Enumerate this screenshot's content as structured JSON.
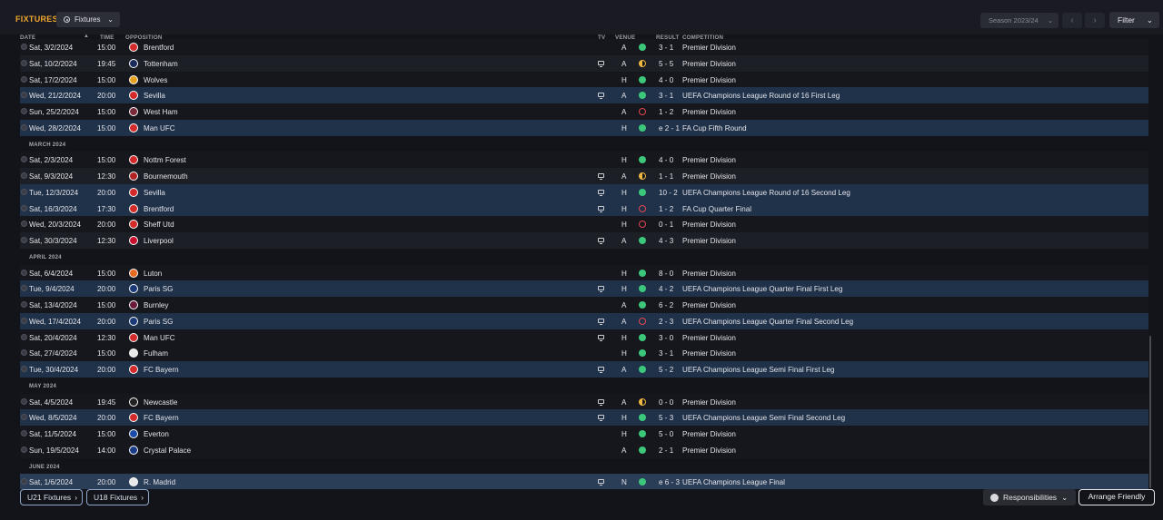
{
  "header": {
    "title": "FIXTURES",
    "view_label": "Fixtures",
    "season_label": "Season 2023/24",
    "filter_label": "Filter"
  },
  "columns": {
    "date": "DATE",
    "time": "TIME",
    "opposition": "OPPOSITION",
    "tv": "TV",
    "venue": "VENUE",
    "result": "RESULT",
    "competition": "COMPETITION"
  },
  "items": [
    {
      "kind": "fixture",
      "date": "Sat, 3/2/2024",
      "time": "15:00",
      "opp": "Brentford",
      "tv": false,
      "venue": "A",
      "outcome": "W",
      "score": "3 - 1",
      "comp": "Premier Division",
      "crest": "#d42a2a",
      "style": "even"
    },
    {
      "kind": "fixture",
      "date": "Sat, 10/2/2024",
      "time": "19:45",
      "opp": "Tottenham",
      "tv": true,
      "venue": "A",
      "outcome": "D",
      "score": "5 - 5",
      "comp": "Premier Division",
      "crest": "#1a2a5a",
      "style": "alt"
    },
    {
      "kind": "fixture",
      "date": "Sat, 17/2/2024",
      "time": "15:00",
      "opp": "Wolves",
      "tv": false,
      "venue": "H",
      "outcome": "W",
      "score": "4 - 0",
      "comp": "Premier Division",
      "crest": "#e8a020",
      "style": "even"
    },
    {
      "kind": "fixture",
      "date": "Wed, 21/2/2024",
      "time": "20:00",
      "opp": "Sevilla",
      "tv": true,
      "venue": "A",
      "outcome": "W",
      "score": "3 - 1",
      "comp": "UEFA Champions League Round of 16 First Leg",
      "crest": "#d42a2a",
      "style": "hl"
    },
    {
      "kind": "fixture",
      "date": "Sun, 25/2/2024",
      "time": "15:00",
      "opp": "West Ham",
      "tv": false,
      "venue": "A",
      "outcome": "L",
      "score": "1 - 2",
      "comp": "Premier Division",
      "crest": "#7a2a3a",
      "style": "even"
    },
    {
      "kind": "fixture",
      "date": "Wed, 28/2/2024",
      "time": "15:00",
      "opp": "Man UFC",
      "tv": false,
      "venue": "H",
      "outcome": "W",
      "score": "e 2 - 1",
      "comp": "FA Cup Fifth Round",
      "crest": "#d42a2a",
      "style": "hl"
    },
    {
      "kind": "month",
      "label": "MARCH 2024"
    },
    {
      "kind": "fixture",
      "date": "Sat, 2/3/2024",
      "time": "15:00",
      "opp": "Nottm Forest",
      "tv": false,
      "venue": "H",
      "outcome": "W",
      "score": "4 - 0",
      "comp": "Premier Division",
      "crest": "#d42a2a",
      "style": "even"
    },
    {
      "kind": "fixture",
      "date": "Sat, 9/3/2024",
      "time": "12:30",
      "opp": "Bournemouth",
      "tv": true,
      "venue": "A",
      "outcome": "D",
      "score": "1 - 1",
      "comp": "Premier Division",
      "crest": "#b22222",
      "style": "alt"
    },
    {
      "kind": "fixture",
      "date": "Tue, 12/3/2024",
      "time": "20:00",
      "opp": "Sevilla",
      "tv": true,
      "venue": "H",
      "outcome": "W",
      "score": "10 - 2",
      "comp": "UEFA Champions League Round of 16  Second Leg",
      "crest": "#d42a2a",
      "style": "hl"
    },
    {
      "kind": "fixture",
      "date": "Sat, 16/3/2024",
      "time": "17:30",
      "opp": "Brentford",
      "tv": true,
      "venue": "H",
      "outcome": "L",
      "score": "1 - 2",
      "comp": "FA Cup Quarter Final",
      "crest": "#d42a2a",
      "style": "hl"
    },
    {
      "kind": "fixture",
      "date": "Wed, 20/3/2024",
      "time": "20:00",
      "opp": "Sheff Utd",
      "tv": false,
      "venue": "H",
      "outcome": "L",
      "score": "0 - 1",
      "comp": "Premier Division",
      "crest": "#d42a2a",
      "style": "even"
    },
    {
      "kind": "fixture",
      "date": "Sat, 30/3/2024",
      "time": "12:30",
      "opp": "Liverpool",
      "tv": true,
      "venue": "A",
      "outcome": "W",
      "score": "4 - 3",
      "comp": "Premier Division",
      "crest": "#c8102e",
      "style": "alt"
    },
    {
      "kind": "month",
      "label": "APRIL 2024"
    },
    {
      "kind": "fixture",
      "date": "Sat, 6/4/2024",
      "time": "15:00",
      "opp": "Luton",
      "tv": false,
      "venue": "H",
      "outcome": "W",
      "score": "8 - 0",
      "comp": "Premier Division",
      "crest": "#e86a20",
      "style": "even"
    },
    {
      "kind": "fixture",
      "date": "Tue, 9/4/2024",
      "time": "20:00",
      "opp": "Paris SG",
      "tv": true,
      "venue": "H",
      "outcome": "W",
      "score": "4 - 2",
      "comp": "UEFA Champions League Quarter Final First Leg",
      "crest": "#1a3a7a",
      "style": "hl"
    },
    {
      "kind": "fixture",
      "date": "Sat, 13/4/2024",
      "time": "15:00",
      "opp": "Burnley",
      "tv": false,
      "venue": "A",
      "outcome": "W",
      "score": "6 - 2",
      "comp": "Premier Division",
      "crest": "#6a1a3a",
      "style": "even"
    },
    {
      "kind": "fixture",
      "date": "Wed, 17/4/2024",
      "time": "20:00",
      "opp": "Paris SG",
      "tv": true,
      "venue": "A",
      "outcome": "L",
      "score": "2 - 3",
      "comp": "UEFA Champions League Quarter Final Second Leg",
      "crest": "#1a3a7a",
      "style": "hl"
    },
    {
      "kind": "fixture",
      "date": "Sat, 20/4/2024",
      "time": "12:30",
      "opp": "Man UFC",
      "tv": true,
      "venue": "H",
      "outcome": "W",
      "score": "3 - 0",
      "comp": "Premier Division",
      "crest": "#d42a2a",
      "style": "even"
    },
    {
      "kind": "fixture",
      "date": "Sat, 27/4/2024",
      "time": "15:00",
      "opp": "Fulham",
      "tv": false,
      "venue": "H",
      "outcome": "W",
      "score": "3 - 1",
      "comp": "Premier Division",
      "crest": "#e8e8e8",
      "style": "even"
    },
    {
      "kind": "fixture",
      "date": "Tue, 30/4/2024",
      "time": "20:00",
      "opp": "FC Bayern",
      "tv": true,
      "venue": "A",
      "outcome": "W",
      "score": "5 - 2",
      "comp": "UEFA Champions League Semi Final First Leg",
      "crest": "#d42a2a",
      "style": "hl"
    },
    {
      "kind": "month",
      "label": "MAY 2024"
    },
    {
      "kind": "fixture",
      "date": "Sat, 4/5/2024",
      "time": "19:45",
      "opp": "Newcastle",
      "tv": true,
      "venue": "A",
      "outcome": "D",
      "score": "0 - 0",
      "comp": "Premier Division",
      "crest": "#222222",
      "style": "even"
    },
    {
      "kind": "fixture",
      "date": "Wed, 8/5/2024",
      "time": "20:00",
      "opp": "FC Bayern",
      "tv": true,
      "venue": "H",
      "outcome": "W",
      "score": "5 - 3",
      "comp": "UEFA Champions League Semi Final Second Leg",
      "crest": "#d42a2a",
      "style": "hl"
    },
    {
      "kind": "fixture",
      "date": "Sat, 11/5/2024",
      "time": "15:00",
      "opp": "Everton",
      "tv": false,
      "venue": "H",
      "outcome": "W",
      "score": "5 - 0",
      "comp": "Premier Division",
      "crest": "#1a4aaa",
      "style": "even"
    },
    {
      "kind": "fixture",
      "date": "Sun, 19/5/2024",
      "time": "14:00",
      "opp": "Crystal Palace",
      "tv": false,
      "venue": "A",
      "outcome": "W",
      "score": "2 - 1",
      "comp": "Premier Division",
      "crest": "#1a3a8a",
      "style": "even"
    },
    {
      "kind": "month",
      "label": "JUNE 2024"
    },
    {
      "kind": "fixture",
      "date": "Sat, 1/6/2024",
      "time": "20:00",
      "opp": "R. Madrid",
      "tv": true,
      "venue": "N",
      "outcome": "W",
      "score": "e 6 - 3",
      "comp": "UEFA Champions League Final",
      "crest": "#e8e8e8",
      "style": "sel"
    }
  ],
  "footer": {
    "u21_label": "U21 Fixtures",
    "u18_label": "U18 Fixtures",
    "responsibilities_label": "Responsibilities",
    "arrange_label": "Arrange Friendly"
  }
}
